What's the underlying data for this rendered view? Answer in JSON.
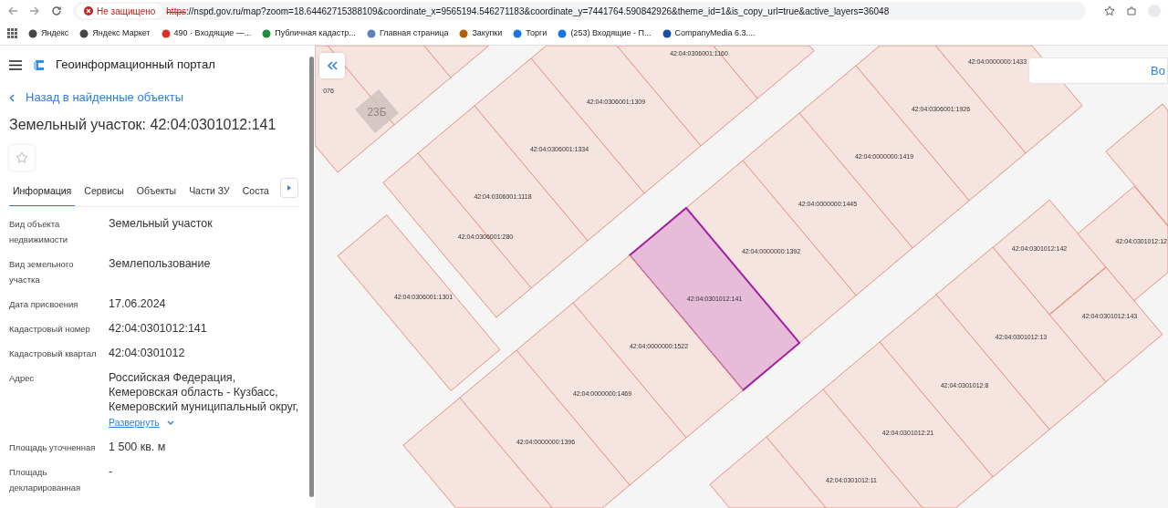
{
  "browser": {
    "security_badge": "Не защищено",
    "url_scheme": "https",
    "url_rest": "://nspd.gov.ru/map?zoom=18.64462715388109&coordinate_x=9565194.546271183&coordinate_y=7441764.590842926&theme_id=1&is_copy_url=true&active_layers=36048",
    "bookmarks": [
      {
        "label": "Яндекс"
      },
      {
        "label": "Яндекс Маркет"
      },
      {
        "label": "490 · Входящие —..."
      },
      {
        "label": "Публичная кадастр..."
      },
      {
        "label": "Главная страница"
      },
      {
        "label": "Закупки"
      },
      {
        "label": "Торги"
      },
      {
        "label": "(253) Входящие - П..."
      },
      {
        "label": "CompanyMedia 6.3...."
      }
    ]
  },
  "panel": {
    "portal_title": "Геоинформационный портал",
    "back_link": "Назад в найденные объекты",
    "heading": "Земельный участок: 42:04:0301012:141",
    "tabs": [
      {
        "label": "Информация",
        "selected": true
      },
      {
        "label": "Сервисы",
        "selected": false
      },
      {
        "label": "Объекты",
        "selected": false
      },
      {
        "label": "Части ЗУ",
        "selected": false
      },
      {
        "label": "Соста",
        "selected": false
      }
    ],
    "properties": [
      {
        "label": "Вид объекта недвижимости",
        "value": "Земельный участок"
      },
      {
        "label": "Вид земельного участка",
        "value": "Землепользование"
      },
      {
        "label": "Дата присвоения",
        "value": "17.06.2024"
      },
      {
        "label": "Кадастровый номер",
        "value": "42:04:0301012:141"
      },
      {
        "label": "Кадастровый квартал",
        "value": "42:04:0301012"
      },
      {
        "label": "Адрес",
        "value": "Российская Федерация,\nКемеровская область - Кузбасс,\nКемеровский муниципальный округ,",
        "expand_link": "Развернуть"
      },
      {
        "label": "Площадь уточненная",
        "value": "1 500 кв. м"
      },
      {
        "label": "Площадь декларированная",
        "value": "-"
      }
    ]
  },
  "map": {
    "corner_button": "Во",
    "buildings": [
      {
        "number": "23Б"
      }
    ],
    "parcels": [
      {
        "number": "076",
        "selected": false
      },
      {
        "number": "42:04:0306001:1160",
        "selected": false
      },
      {
        "number": "42:04:0000000:1433",
        "selected": false
      },
      {
        "number": "42:04:0306001:1309",
        "selected": false
      },
      {
        "number": "42:04:0306001:1926",
        "selected": false
      },
      {
        "number": "42:04:0306001:1334",
        "selected": false
      },
      {
        "number": "42:04:0000000:1419",
        "selected": false
      },
      {
        "number": "42:04:0306001:1118",
        "selected": false
      },
      {
        "number": "42:04:0000000:1445",
        "selected": false
      },
      {
        "number": "42:04:0306001:280",
        "selected": false
      },
      {
        "number": "42:04:0000000:1392",
        "selected": false
      },
      {
        "number": "42:04:0301012:142",
        "selected": false
      },
      {
        "number": "42:04:0301012:12",
        "selected": false
      },
      {
        "number": "42:04:0306001:1301",
        "selected": false
      },
      {
        "number": "42:04:0301012:141",
        "selected": true
      },
      {
        "number": "42:04:0301012:143",
        "selected": false
      },
      {
        "number": "42:04:0301012:13",
        "selected": false
      },
      {
        "number": "42:04:0000000:1522",
        "selected": false
      },
      {
        "number": "42:04:0301012:8",
        "selected": false
      },
      {
        "number": "42:04:0000000:1469",
        "selected": false
      },
      {
        "number": "42:04:0301012:21",
        "selected": false
      },
      {
        "number": "42:04:0000000:1396",
        "selected": false
      },
      {
        "number": "42:04:0301012:11",
        "selected": false
      }
    ]
  }
}
